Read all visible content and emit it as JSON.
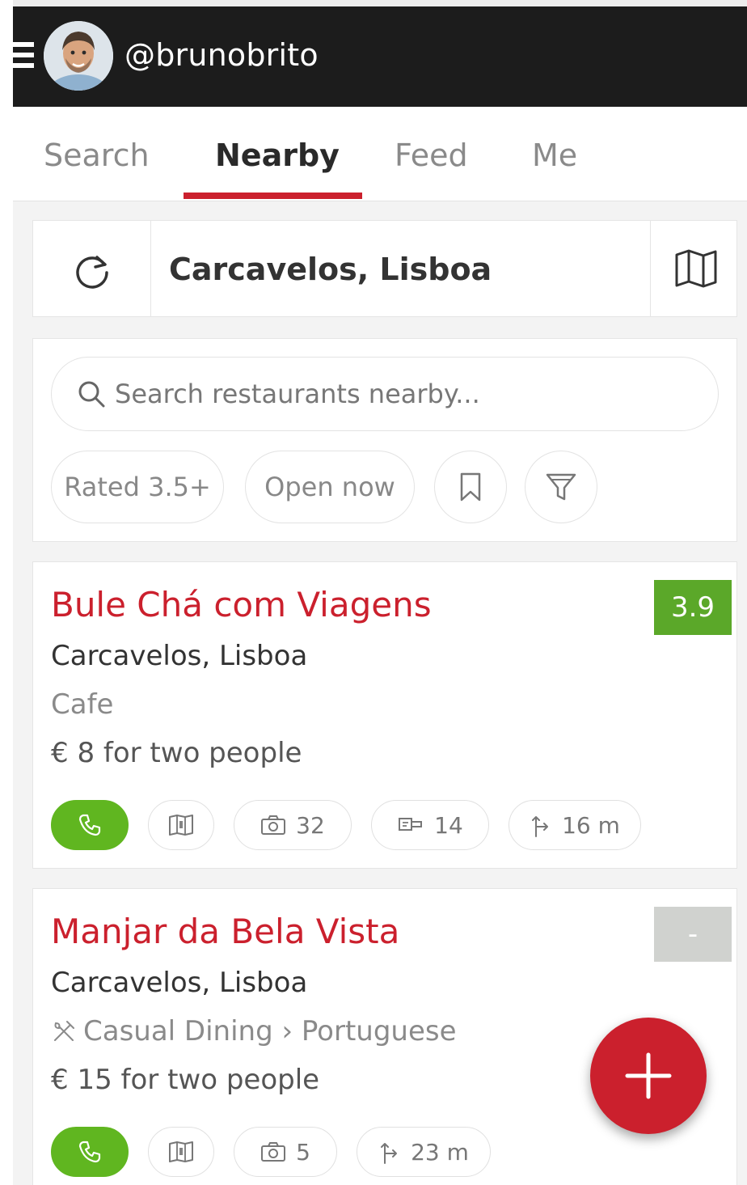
{
  "header": {
    "username": "@brunobrito"
  },
  "tabs": [
    {
      "label": "Search"
    },
    {
      "label": "Nearby"
    },
    {
      "label": "Feed"
    },
    {
      "label": "Me"
    }
  ],
  "active_tab": "Nearby",
  "location": {
    "text": "Carcavelos, Lisboa"
  },
  "search": {
    "placeholder": "Search restaurants nearby..."
  },
  "filters": {
    "rated": "Rated 3.5+",
    "open_now": "Open now"
  },
  "colors": {
    "brand_red": "#cb202d",
    "rating_green": "#5ba829",
    "rating_none": "#d0d2cf",
    "call_green": "#60b620",
    "topbar": "#1c1c1c"
  },
  "restaurants": [
    {
      "name": "Bule Chá com Viagens",
      "rating": "3.9",
      "location": "Carcavelos, Lisboa",
      "type": "Cafe",
      "cost": "€ 8 for two people",
      "photos": "32",
      "reviews": "14",
      "distance": "16 m"
    },
    {
      "name": "Manjar da Bela Vista",
      "rating": "-",
      "location": "Carcavelos, Lisboa",
      "type": "Casual Dining › Portuguese",
      "cost": "€ 15 for two people",
      "photos": "5",
      "distance": "23 m"
    }
  ],
  "icons": [
    "hamburger-icon",
    "refresh-icon",
    "map-icon",
    "search-icon",
    "bookmark-icon",
    "filter-icon",
    "phone-icon",
    "menu-book-icon",
    "camera-icon",
    "review-icon",
    "directions-icon",
    "cutlery-icon",
    "plus-icon"
  ]
}
